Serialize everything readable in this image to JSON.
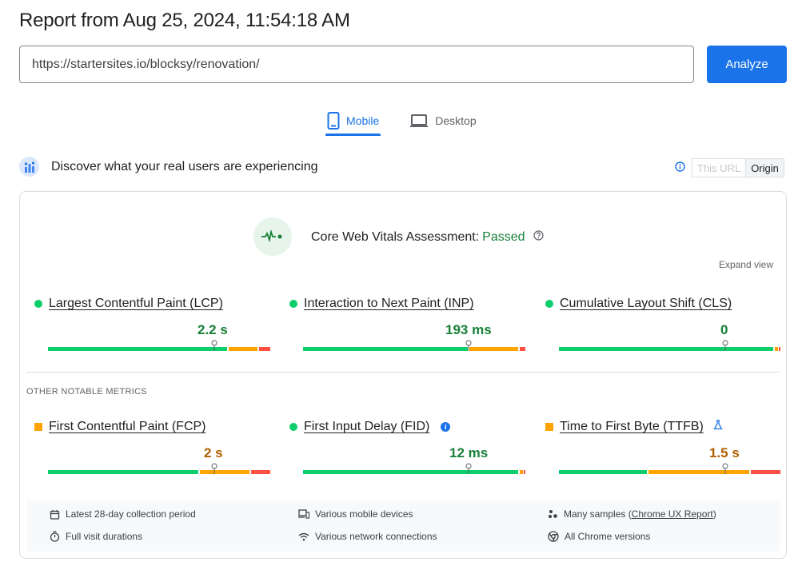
{
  "header": {
    "title": "Report from Aug 25, 2024, 11:54:18 AM",
    "url_value": "https://startersites.io/blocksy/renovation/",
    "analyze_label": "Analyze"
  },
  "tabs": [
    {
      "label": "Mobile",
      "active": true
    },
    {
      "label": "Desktop",
      "active": false
    }
  ],
  "crux": {
    "title": "Discover what your real users are experiencing",
    "toggle_this_url": "This URL",
    "toggle_origin": "Origin"
  },
  "assessment": {
    "label": "Core Web Vitals Assessment:",
    "status": "Passed",
    "expand": "Expand view"
  },
  "core_metrics": [
    {
      "name": "Largest Contentful Paint (LCP)",
      "value": "2.2 s",
      "rating": "good"
    },
    {
      "name": "Interaction to Next Paint (INP)",
      "value": "193 ms",
      "rating": "good"
    },
    {
      "name": "Cumulative Layout Shift (CLS)",
      "value": "0",
      "rating": "good"
    }
  ],
  "other_heading": "OTHER NOTABLE METRICS",
  "other_metrics": [
    {
      "name": "First Contentful Paint (FCP)",
      "value": "2 s",
      "rating": "needs-improvement"
    },
    {
      "name": "First Input Delay (FID)",
      "value": "12 ms",
      "rating": "good"
    },
    {
      "name": "Time to First Byte (TTFB)",
      "value": "1.5 s",
      "rating": "needs-improvement"
    }
  ],
  "footer": {
    "collection_period": "Latest 28-day collection period",
    "visit_durations": "Full visit durations",
    "devices": "Various mobile devices",
    "network": "Various network connections",
    "samples_prefix": "Many samples (",
    "samples_link": "Chrome UX Report",
    "samples_suffix": ")",
    "chrome_versions": "All Chrome versions"
  },
  "colors": {
    "good": "#0cce6b",
    "needs_improvement": "#ffa400",
    "poor": "#ff4e42",
    "accent": "#1a73e8"
  }
}
